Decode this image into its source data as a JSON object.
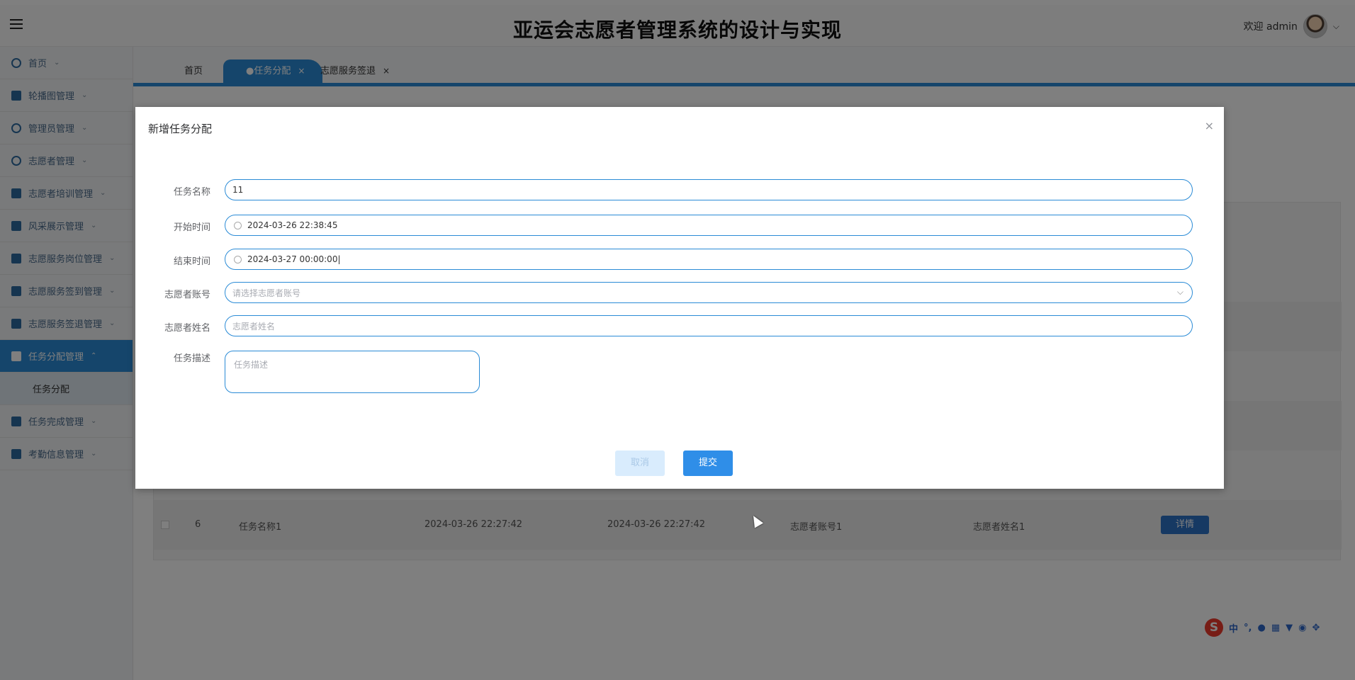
{
  "header": {
    "title": "亚运会志愿者管理系统的设计与实现",
    "welcome": "欢迎 admin"
  },
  "sidebar": {
    "items": [
      {
        "label": "首页",
        "icon": "home-icon"
      },
      {
        "label": "轮播图管理",
        "icon": "carousel-icon"
      },
      {
        "label": "管理员管理",
        "icon": "admin-icon"
      },
      {
        "label": "志愿者管理",
        "icon": "user-icon"
      },
      {
        "label": "志愿者培训管理",
        "icon": "book-icon"
      },
      {
        "label": "风采展示管理",
        "icon": "gallery-icon"
      },
      {
        "label": "志愿服务岗位管理",
        "icon": "grid-icon"
      },
      {
        "label": "志愿服务签到管理",
        "icon": "checkin-icon"
      },
      {
        "label": "志愿服务签退管理",
        "icon": "checkout-icon"
      },
      {
        "label": "任务分配管理",
        "icon": "task-icon"
      },
      {
        "label": "任务完成管理",
        "icon": "done-icon"
      },
      {
        "label": "考勤信息管理",
        "icon": "attendance-icon"
      }
    ],
    "sub_items": [
      {
        "label": "任务分配"
      }
    ]
  },
  "tabs": [
    {
      "label": "首页"
    },
    {
      "label": "●任务分配",
      "close": "×"
    },
    {
      "label": "志愿服务签退",
      "close": "×"
    }
  ],
  "table": {
    "row": {
      "index": "6",
      "task_name": "任务名称1",
      "start_time": "2024-03-26 22:27:42",
      "end_time": "2024-03-26 22:27:42",
      "account": "志愿者账号1",
      "name": "志愿者姓名1",
      "detail_label": "详情"
    }
  },
  "dialog": {
    "title": "新增任务分配",
    "close": "×",
    "fields": {
      "task_name": {
        "label": "任务名称",
        "value": "11"
      },
      "start_time": {
        "label": "开始时间",
        "value": "2024-03-26 22:38:45"
      },
      "end_time": {
        "label": "结束时间",
        "value": "2024-03-27 00:00:00|"
      },
      "account": {
        "label": "志愿者账号",
        "placeholder": "请选择志愿者账号"
      },
      "volunteer_name": {
        "label": "志愿者姓名",
        "placeholder": "志愿者姓名"
      },
      "description": {
        "label": "任务描述",
        "placeholder": "任务描述"
      }
    },
    "cancel_label": "取消",
    "submit_label": "提交"
  },
  "ime": {
    "logo": "S",
    "lang": "中"
  },
  "colors": {
    "accent": "#2a8bd6",
    "submit": "#2f8ee8",
    "detail_button": "#2d73c7"
  }
}
